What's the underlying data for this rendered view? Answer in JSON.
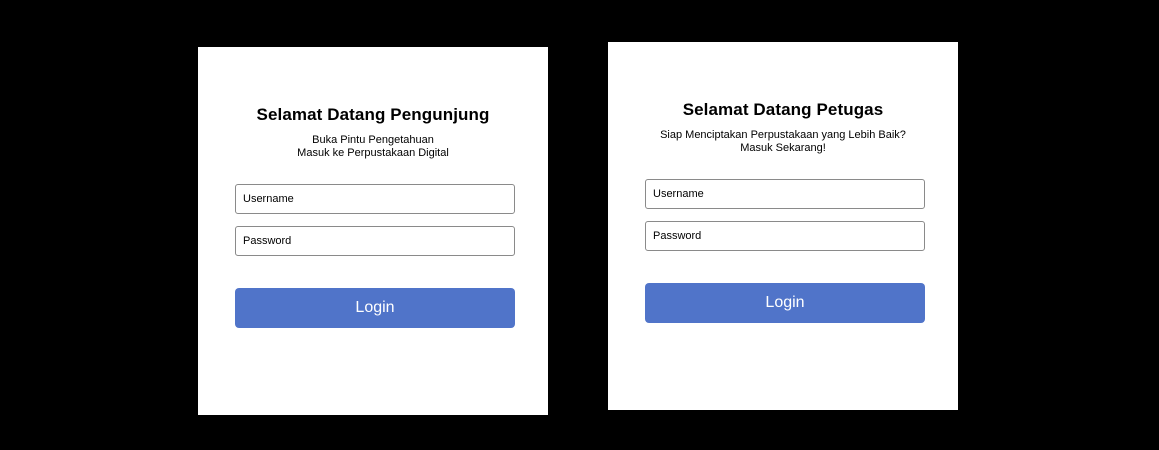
{
  "visitor_card": {
    "title": "Selamat Datang Pengunjung",
    "subtitle_line1": "Buka Pintu Pengetahuan",
    "subtitle_line2": "Masuk ke Perpustakaan Digital",
    "username_placeholder": "Username",
    "password_placeholder": "Password",
    "login_label": "Login"
  },
  "staff_card": {
    "title": "Selamat Datang Petugas",
    "subtitle_line1": "Siap Menciptakan Perpustakaan yang Lebih Baik?",
    "subtitle_line2": "Masuk Sekarang!",
    "username_placeholder": "Username",
    "password_placeholder": "Password",
    "login_label": "Login"
  },
  "colors": {
    "background": "#000000",
    "card": "#ffffff",
    "button": "#5074c9",
    "field_border": "#8a8a8a"
  }
}
